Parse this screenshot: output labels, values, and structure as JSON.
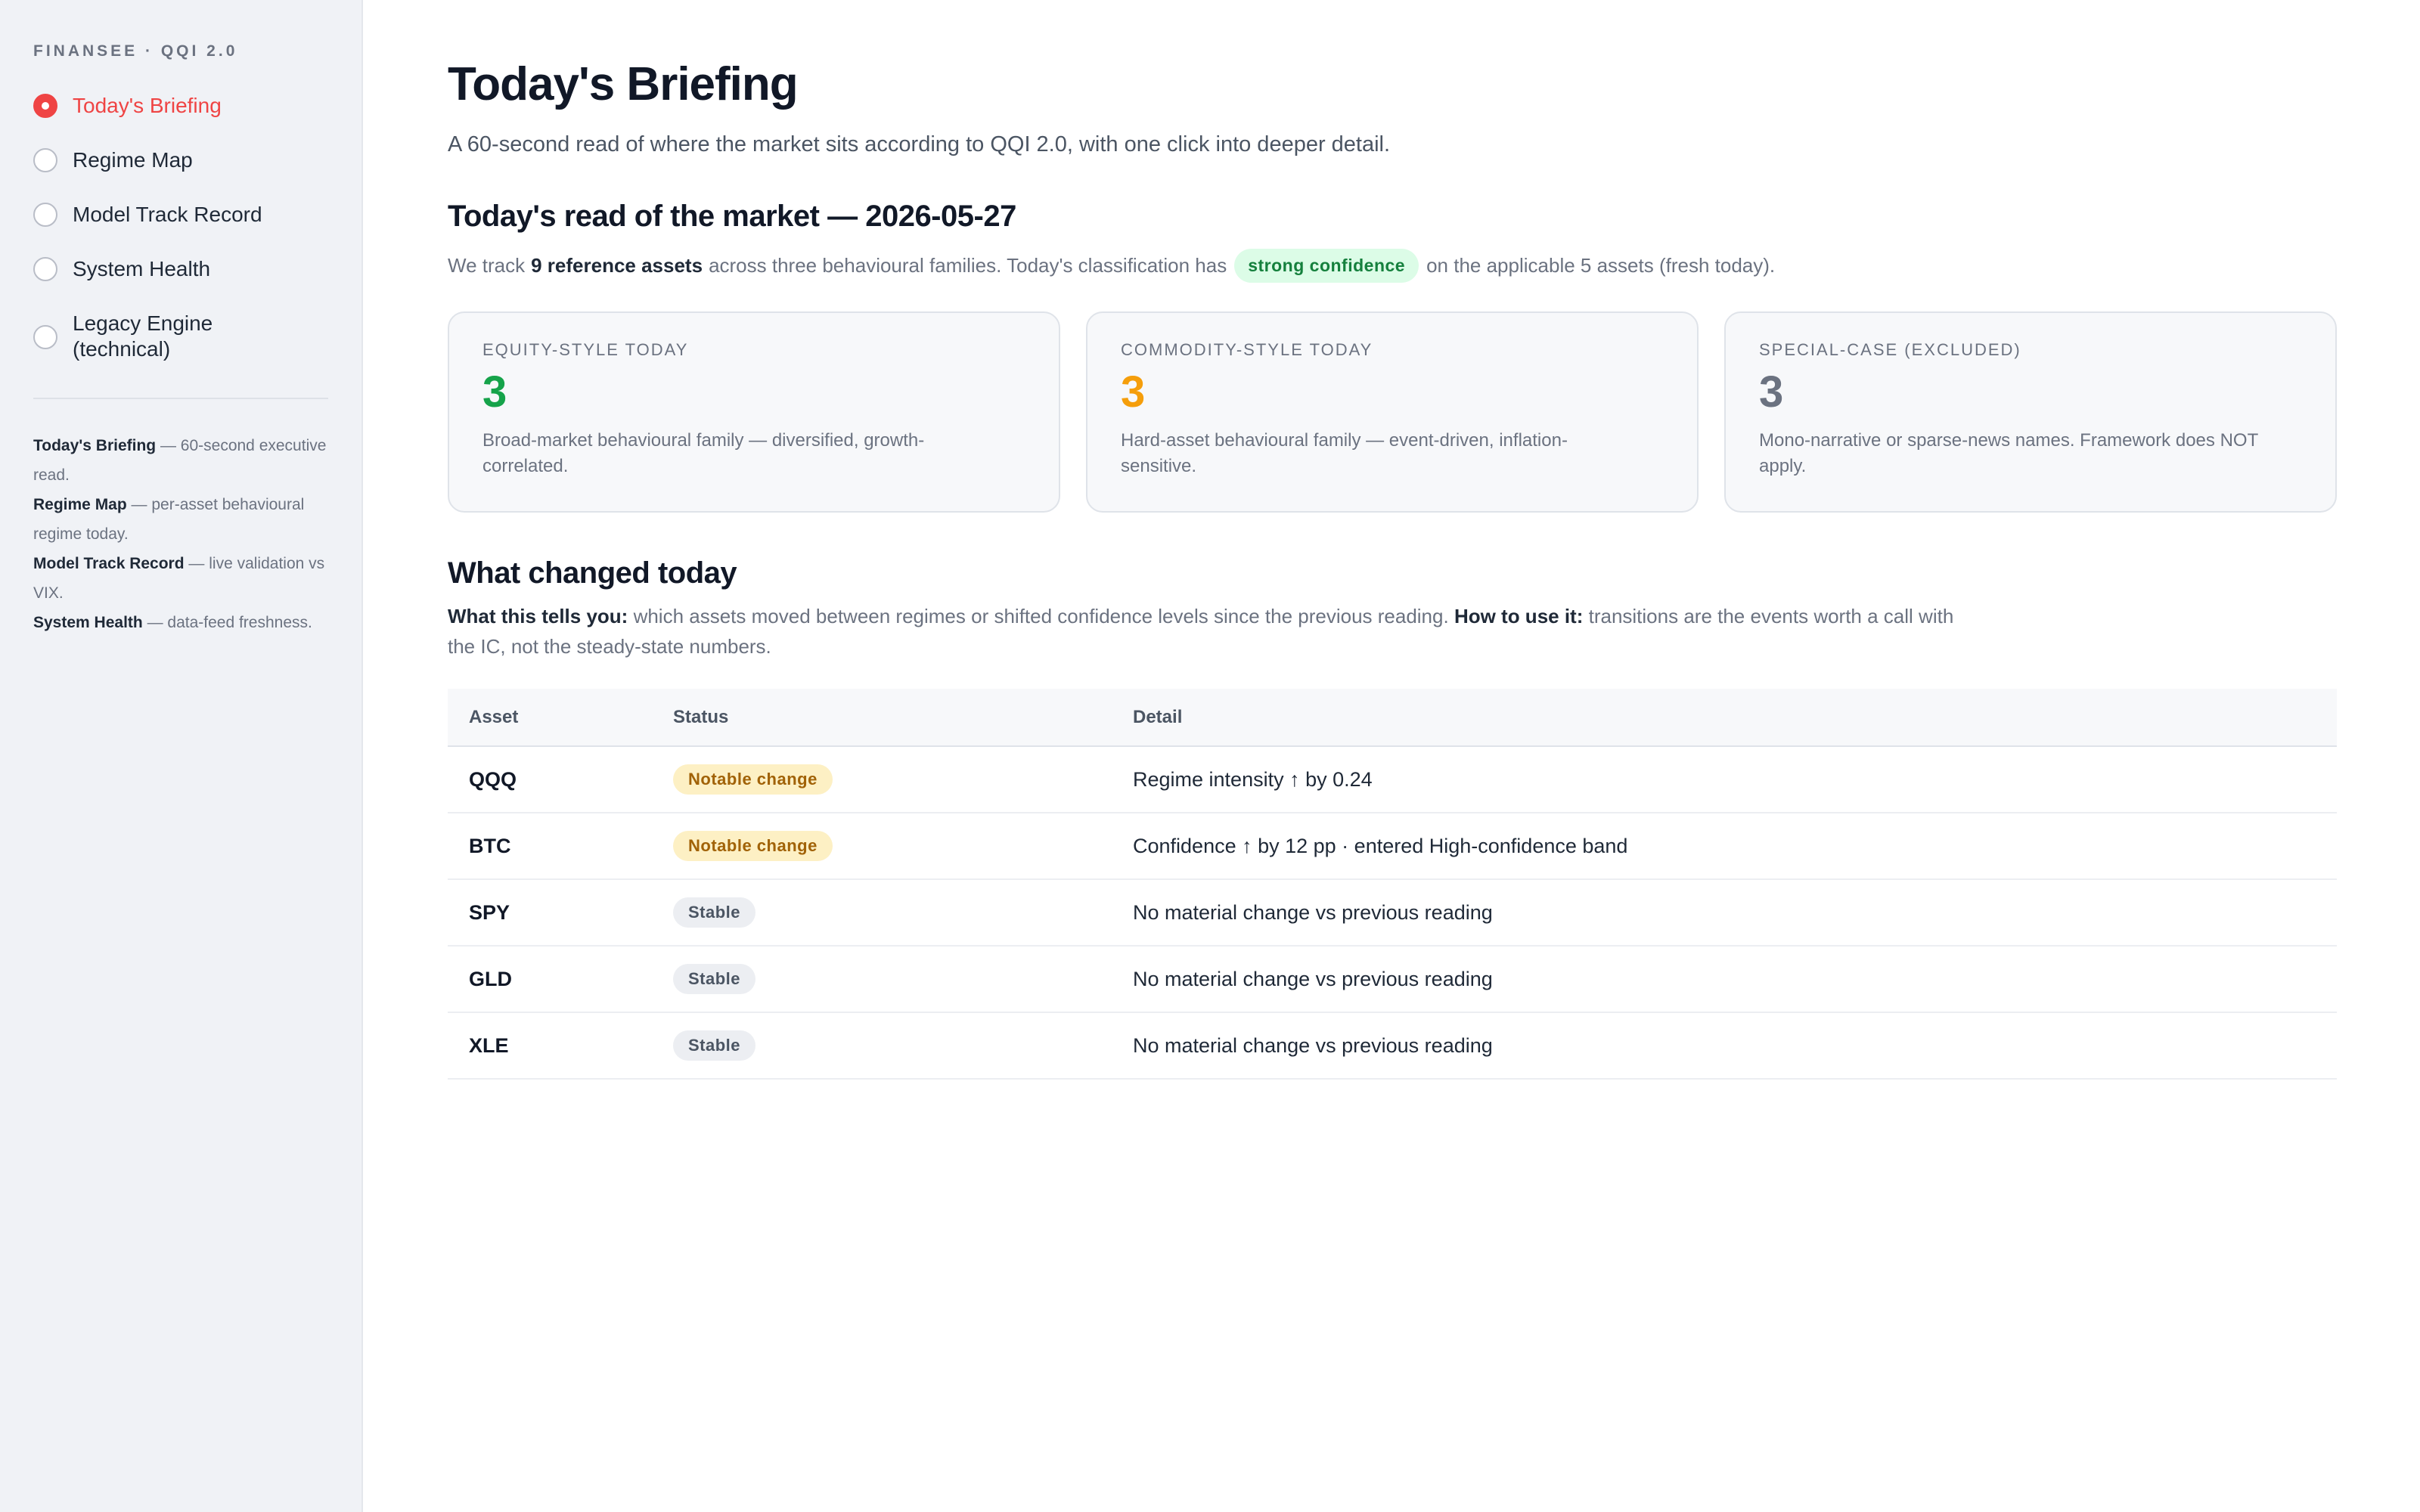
{
  "app": {
    "brand": "FINANSEE · QQI 2.0"
  },
  "sidebar": {
    "items": [
      {
        "label": "Today's Briefing",
        "active": true
      },
      {
        "label": "Regime Map",
        "active": false
      },
      {
        "label": "Model Track Record",
        "active": false
      },
      {
        "label": "System Health",
        "active": false
      },
      {
        "label": "Legacy Engine (technical)",
        "active": false
      }
    ],
    "help": [
      {
        "term": "Today's Briefing",
        "desc": " — 60-second executive read."
      },
      {
        "term": "Regime Map",
        "desc": " — per-asset behavioural regime today."
      },
      {
        "term": "Model Track Record",
        "desc": " — live validation vs VIX."
      },
      {
        "term": "System Health",
        "desc": " — data-feed freshness."
      }
    ]
  },
  "main": {
    "title": "Today's Briefing",
    "subtitle": "A 60-second read of where the market sits according to QQI 2.0, with one click into deeper detail.",
    "read_title": "Today's read of the market — 2026-05-27",
    "track": {
      "prefix": "We track",
      "bold": "9 reference assets",
      "middle": "across three behavioural families. Today's classification has",
      "pill": "strong confidence",
      "suffix": "on the applicable 5 assets (fresh today)."
    },
    "cards": [
      {
        "label": "EQUITY-STYLE TODAY",
        "value": "3",
        "color": "#16a34a",
        "desc": "Broad-market behavioural family — diversified, growth-correlated."
      },
      {
        "label": "COMMODITY-STYLE TODAY",
        "value": "3",
        "color": "#f59e0b",
        "desc": "Hard-asset behavioural family — event-driven, inflation-sensitive."
      },
      {
        "label": "SPECIAL-CASE (EXCLUDED)",
        "value": "3",
        "color": "#6b7280",
        "desc": "Mono-narrative or sparse-news names. Framework does NOT apply."
      }
    ],
    "changes": {
      "title": "What changed today",
      "what_label": "What this tells you:",
      "what_text": " which assets moved between regimes or shifted confidence levels since the previous reading. ",
      "how_label": "How to use it:",
      "how_text": " transitions are the events worth a call with the IC, not the steady-state numbers.",
      "columns": [
        "Asset",
        "Status",
        "Detail"
      ],
      "rows": [
        {
          "asset": "QQQ",
          "status": "Notable change",
          "kind": "notable",
          "detail": "Regime intensity ↑ by 0.24"
        },
        {
          "asset": "BTC",
          "status": "Notable change",
          "kind": "notable",
          "detail": "Confidence ↑ by 12 pp · entered High-confidence band"
        },
        {
          "asset": "SPY",
          "status": "Stable",
          "kind": "stable",
          "detail": "No material change vs previous reading"
        },
        {
          "asset": "GLD",
          "status": "Stable",
          "kind": "stable",
          "detail": "No material change vs previous reading"
        },
        {
          "asset": "XLE",
          "status": "Stable",
          "kind": "stable",
          "detail": "No material change vs previous reading"
        }
      ]
    }
  }
}
